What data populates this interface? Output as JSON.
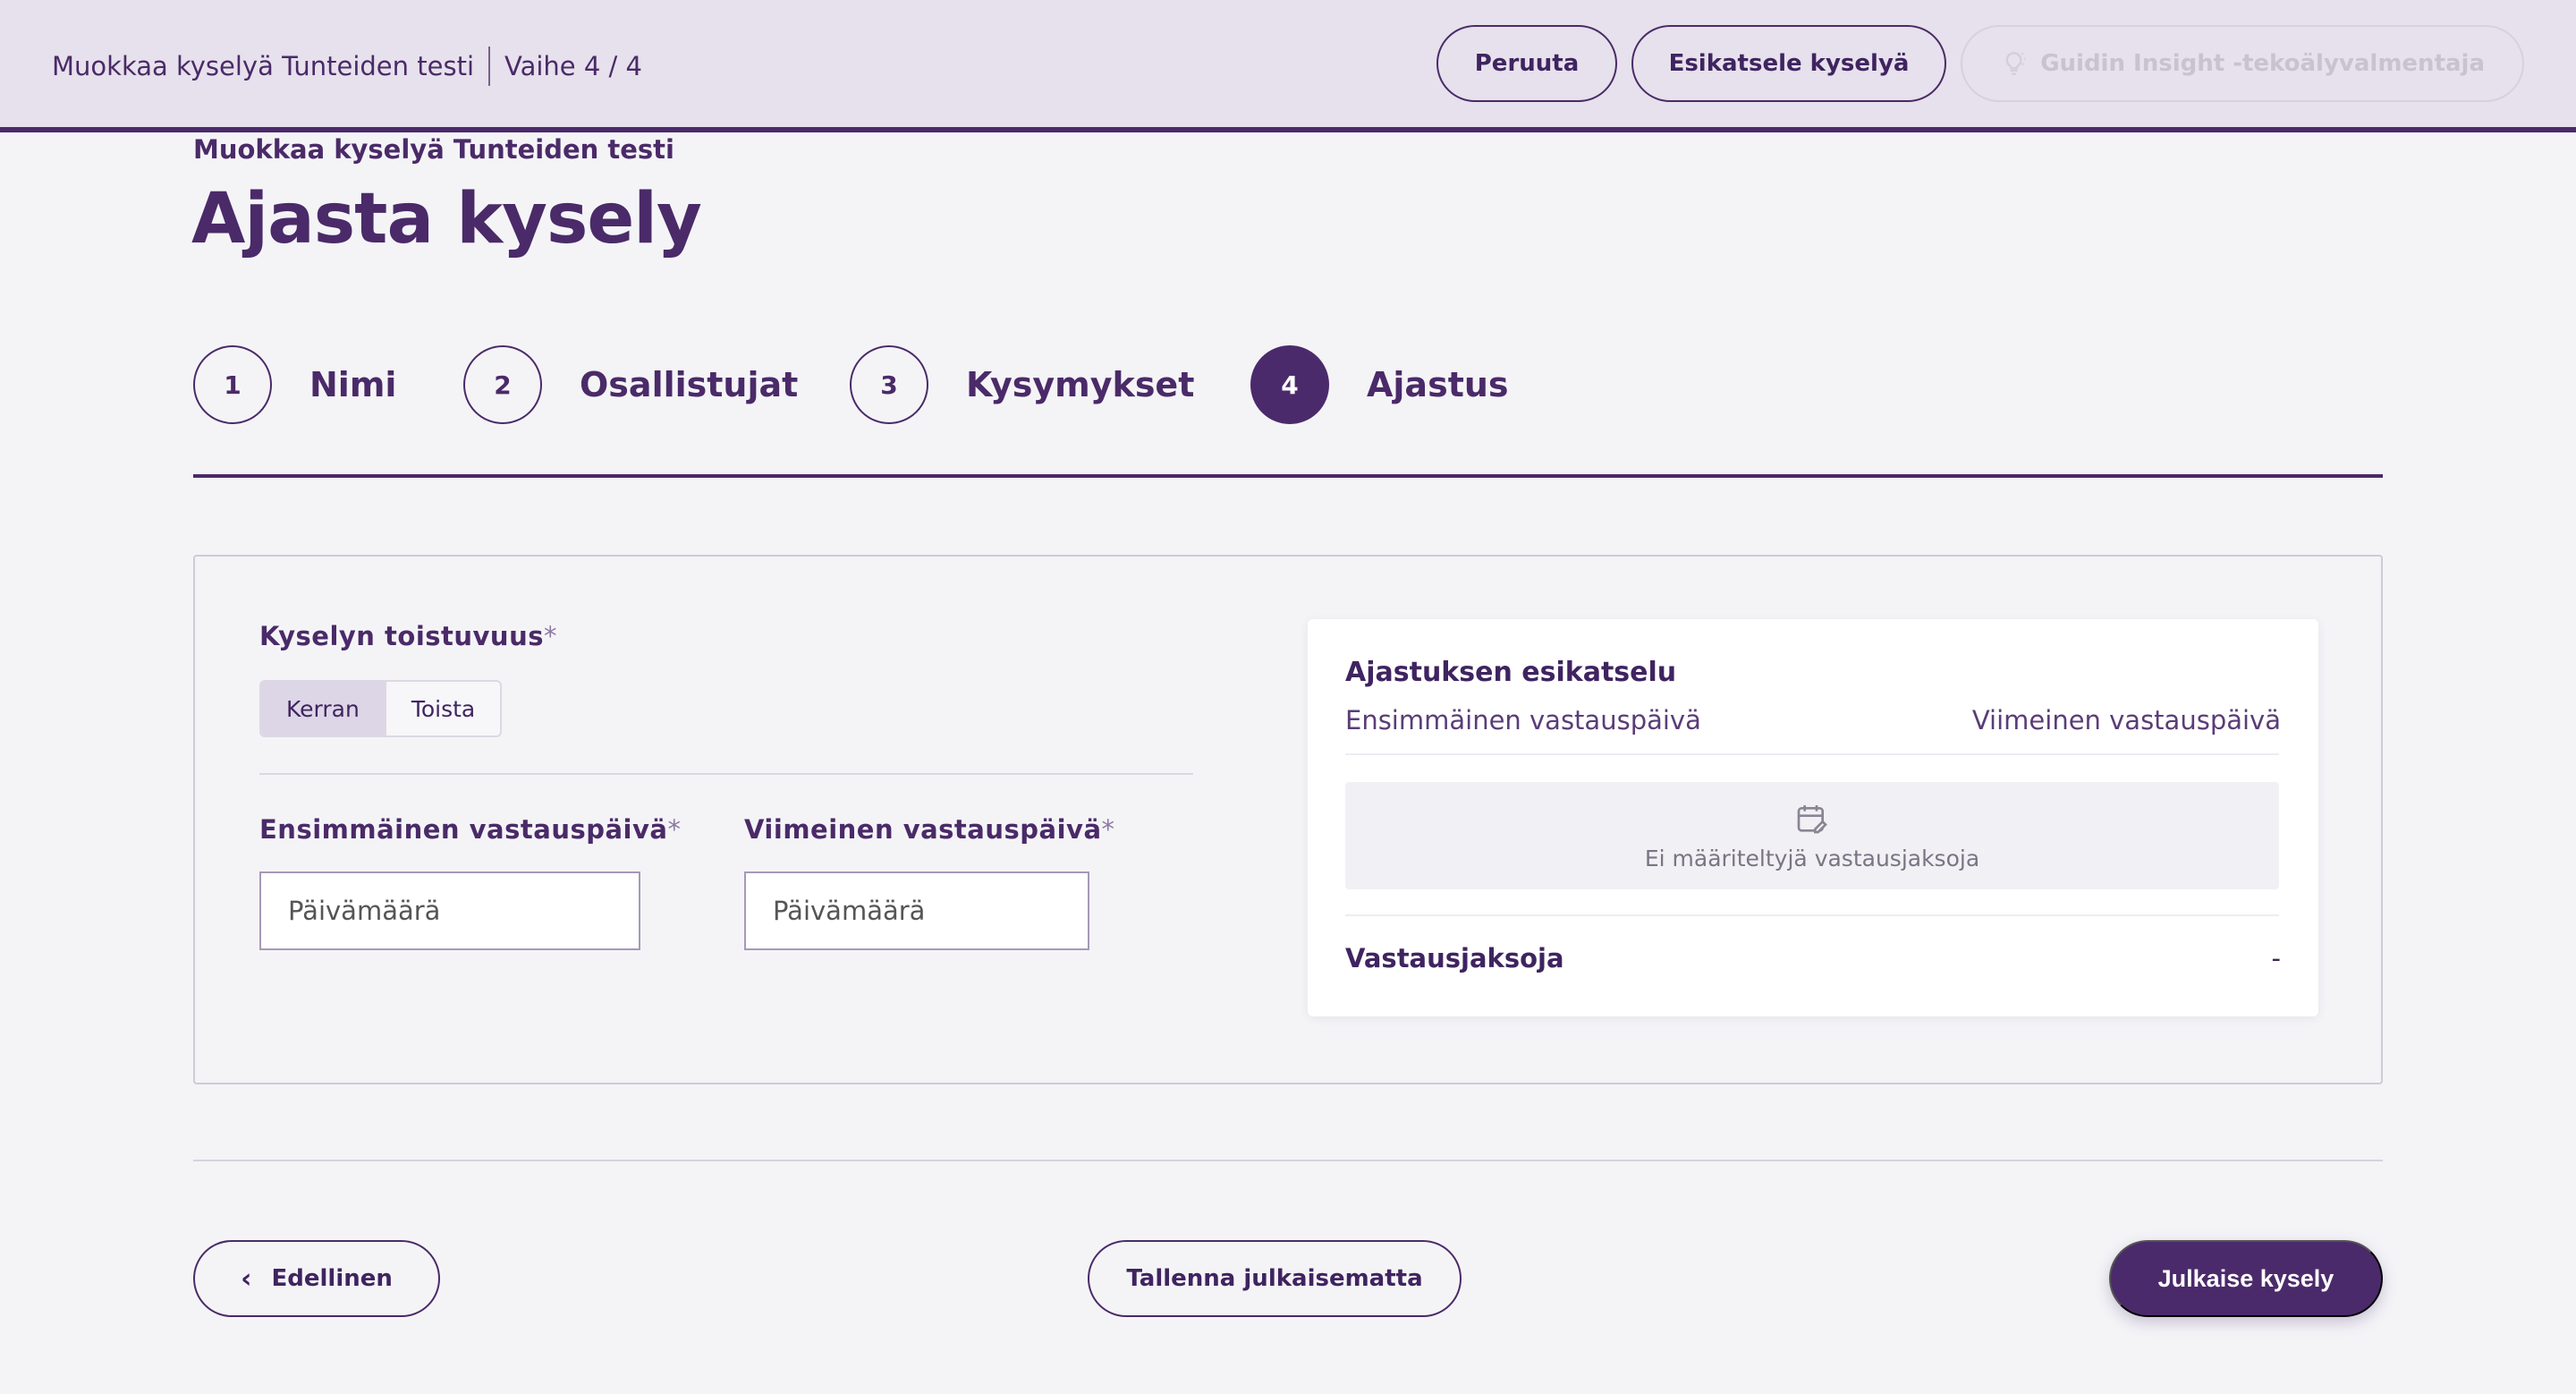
{
  "topbar": {
    "title": "Muokkaa kyselyä Tunteiden testi",
    "step": "Vaihe 4 / 4",
    "cancel_label": "Peruuta",
    "preview_label": "Esikatsele kyselyä",
    "coach_label": "Guidin Insight -tekoälyvalmentaja",
    "coach_icon": "lightbulb-icon"
  },
  "header": {
    "breadcrumb": "Muokkaa kyselyä Tunteiden testi",
    "title": "Ajasta kysely"
  },
  "steps": [
    {
      "num": "1",
      "label": "Nimi"
    },
    {
      "num": "2",
      "label": "Osallistujat"
    },
    {
      "num": "3",
      "label": "Kysymykset"
    },
    {
      "num": "4",
      "label": "Ajastus",
      "active": true
    }
  ],
  "form": {
    "frequency_label": "Kyselyn toistuvuus",
    "required_mark": "*",
    "frequency_options": [
      "Kerran",
      "Toista"
    ],
    "frequency_selected": "Kerran",
    "first_date_label": "Ensimmäinen vastauspäivä",
    "last_date_label": "Viimeinen vastauspäivä",
    "first_date_placeholder": "Päivämäärä",
    "last_date_placeholder": "Päivämäärä"
  },
  "preview": {
    "title": "Ajastuksen esikatselu",
    "col_first": "Ensimmäinen vastauspäivä",
    "col_last": "Viimeinen vastauspäivä",
    "empty_icon": "calendar-edit-icon",
    "empty_text": "Ei määriteltyjä vastausjaksoja",
    "summary_label": "Vastausjaksoja",
    "summary_value": "-"
  },
  "footer": {
    "prev_label": "Edellinen",
    "save_label": "Tallenna julkaisematta",
    "publish_label": "Julkaise kysely"
  },
  "colors": {
    "brand": "#4b2a6b",
    "topbar_bg": "#e6e1ec",
    "page_bg": "#f4f4f7"
  }
}
